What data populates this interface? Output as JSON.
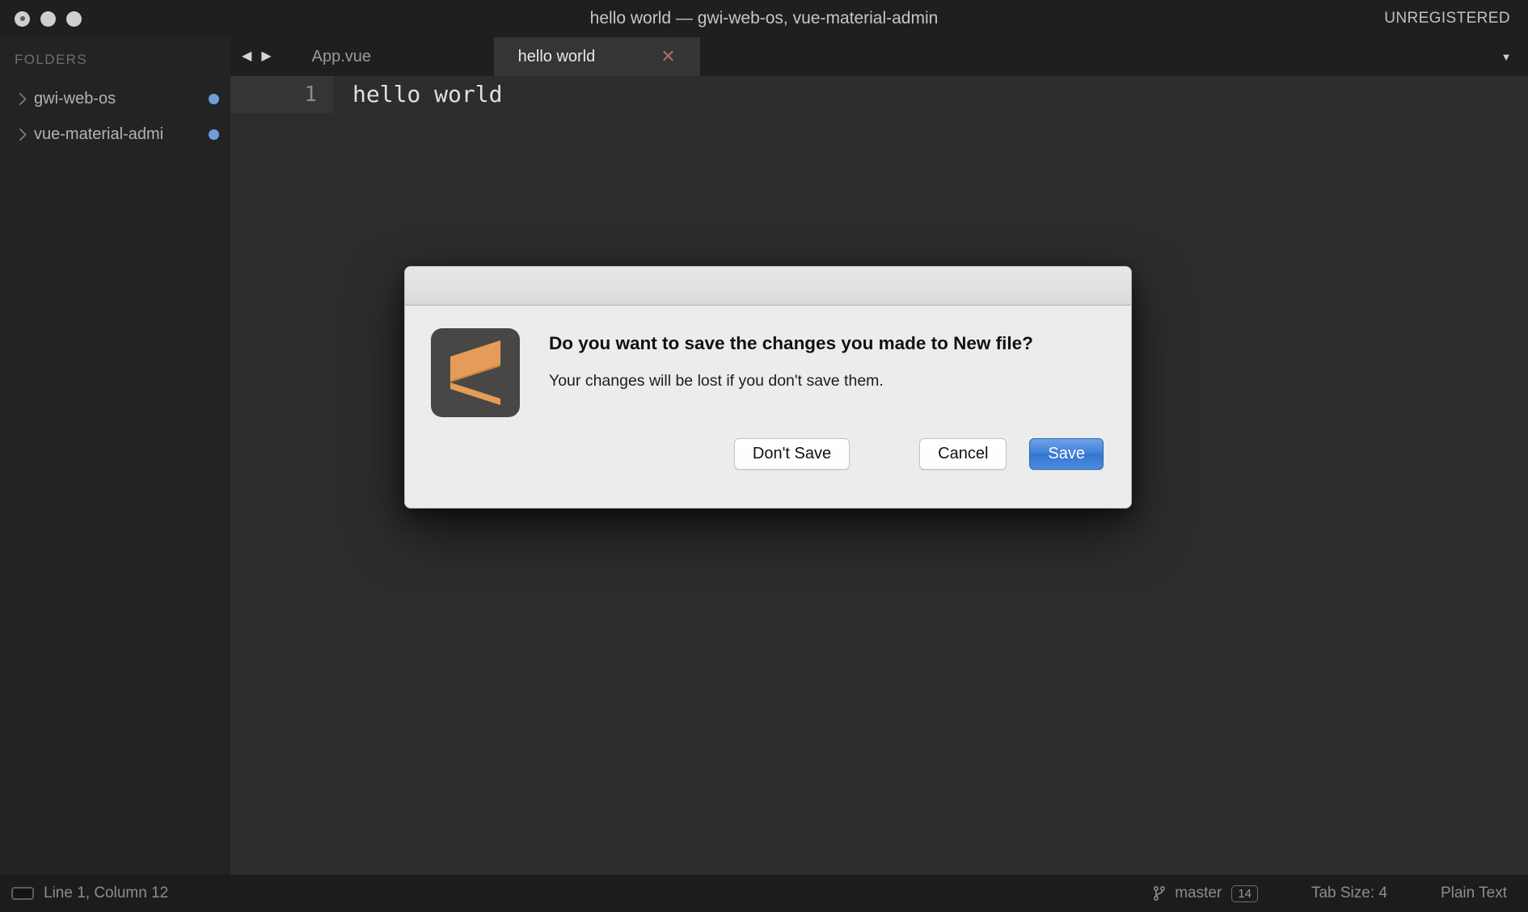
{
  "window": {
    "title": "hello world — gwi-web-os, vue-material-admin",
    "license_status": "UNREGISTERED",
    "traffic_lights": [
      "close",
      "minimize",
      "zoom"
    ]
  },
  "sidebar": {
    "header": "FOLDERS",
    "items": [
      {
        "label": "gwi-web-os",
        "chevron": "chevron-right-icon",
        "badge_color": "#6f9fd8"
      },
      {
        "label": "vue-material-admi",
        "chevron": "chevron-right-icon",
        "badge_color": "#6f9fd8"
      }
    ]
  },
  "tabbar": {
    "nav_prev": "◀",
    "nav_next": "▶",
    "dropdown": "▼",
    "tabs": [
      {
        "label": "App.vue",
        "active": false,
        "close": ""
      },
      {
        "label": "hello world",
        "active": true,
        "close": "✕"
      }
    ]
  },
  "editor": {
    "lines": [
      {
        "number": "1",
        "text": "hello world"
      }
    ]
  },
  "statusbar": {
    "cursor": "Line 1, Column 12",
    "branch": "master",
    "branch_badge": "14",
    "tab_size": "Tab Size: 4",
    "syntax": "Plain Text"
  },
  "dialog": {
    "title": "Do you want to save the changes you made to New file?",
    "subtitle": "Your changes will be lost if you don't save them.",
    "icon": "sublime-text-icon",
    "buttons": {
      "dont_save": "Don't Save",
      "cancel": "Cancel",
      "save": "Save"
    },
    "accent_color": "#3f7fd8"
  }
}
